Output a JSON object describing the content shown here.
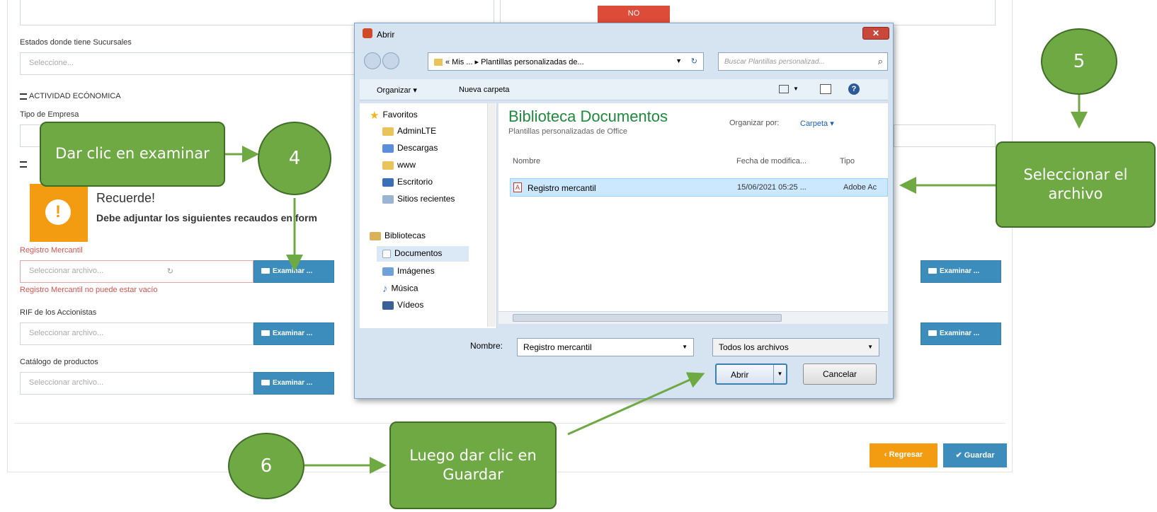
{
  "form": {
    "no_badge": "NO",
    "estados_label": "Estados donde tiene Sucursales",
    "estados_placeholder": "Seleccione...",
    "actividad_title": "ACTIVIDAD ECÓNOMICA",
    "tipo_empresa_label": "Tipo de Empresa",
    "alert_title": "Recuerde!",
    "alert_text": "Debe adjuntar los siguientes recaudos en form",
    "registro_label": "Registro Mercantil",
    "registro_placeholder": "Seleccionar archivo...",
    "registro_error": "Registro Mercantil no puede estar vacío",
    "rif_label": "RIF de los Accionistas",
    "rif_placeholder": "Seleccionar archivo...",
    "catalogo_label": "Catálogo de productos",
    "catalogo_placeholder": "Seleccionar archivo...",
    "examinar_label": "Examinar ...",
    "regresar_label": "Regresar",
    "guardar_label": "Guardar"
  },
  "dialog": {
    "title": "Abrir",
    "address_path": "« Mis ... ▸ Plantillas personalizadas de...",
    "search_placeholder": "Buscar Plantillas personalizad...",
    "toolbar_organize": "Organizar ▾",
    "toolbar_new_folder": "Nueva carpeta",
    "nav_items": [
      {
        "label": "Favoritos",
        "icon": "star-icon",
        "color": "#f2b619"
      },
      {
        "label": "AdminLTE",
        "icon": "folder-icon",
        "color": "#e8c45a"
      },
      {
        "label": "Descargas",
        "icon": "downloads-icon",
        "color": "#5a8ed8"
      },
      {
        "label": "www",
        "icon": "folder-icon",
        "color": "#e8c45a"
      },
      {
        "label": "Escritorio",
        "icon": "desktop-icon",
        "color": "#3b6fb6"
      },
      {
        "label": "Sitios recientes",
        "icon": "recent-icon",
        "color": "#9ab4d2"
      },
      {
        "label": "Bibliotecas",
        "icon": "library-icon",
        "color": "#d9b25a"
      },
      {
        "label": "Documentos",
        "icon": "document-icon",
        "color": "#d7dde6"
      },
      {
        "label": "Imágenes",
        "icon": "images-icon",
        "color": "#6fa0d8"
      },
      {
        "label": "Música",
        "icon": "music-icon",
        "color": "#4d7fc0"
      },
      {
        "label": "Vídeos",
        "icon": "video-icon",
        "color": "#3a5f95"
      }
    ],
    "library_title": "Biblioteca Documentos",
    "library_subtitle": "Plantillas personalizadas de Office",
    "arrange_label": "Organizar por:",
    "arrange_value": "Carpeta ▾",
    "columns": [
      "Nombre",
      "Fecha de modifica...",
      "Tipo"
    ],
    "file_row": {
      "name": "Registro mercantil",
      "date": "15/06/2021 05:25 ...",
      "type": "Adobe Ac"
    },
    "name_label": "Nombre:",
    "name_value": "Registro mercantil",
    "filter_value": "Todos los archivos",
    "open_label": "Abrir",
    "cancel_label": "Cancelar"
  },
  "annotations": {
    "step4_text": "Dar clic en examinar",
    "step4_number": "4",
    "step5_text": "Seleccionar el archivo",
    "step5_number": "5",
    "step6_text": "Luego dar clic en  Guardar",
    "step6_number": "6"
  }
}
